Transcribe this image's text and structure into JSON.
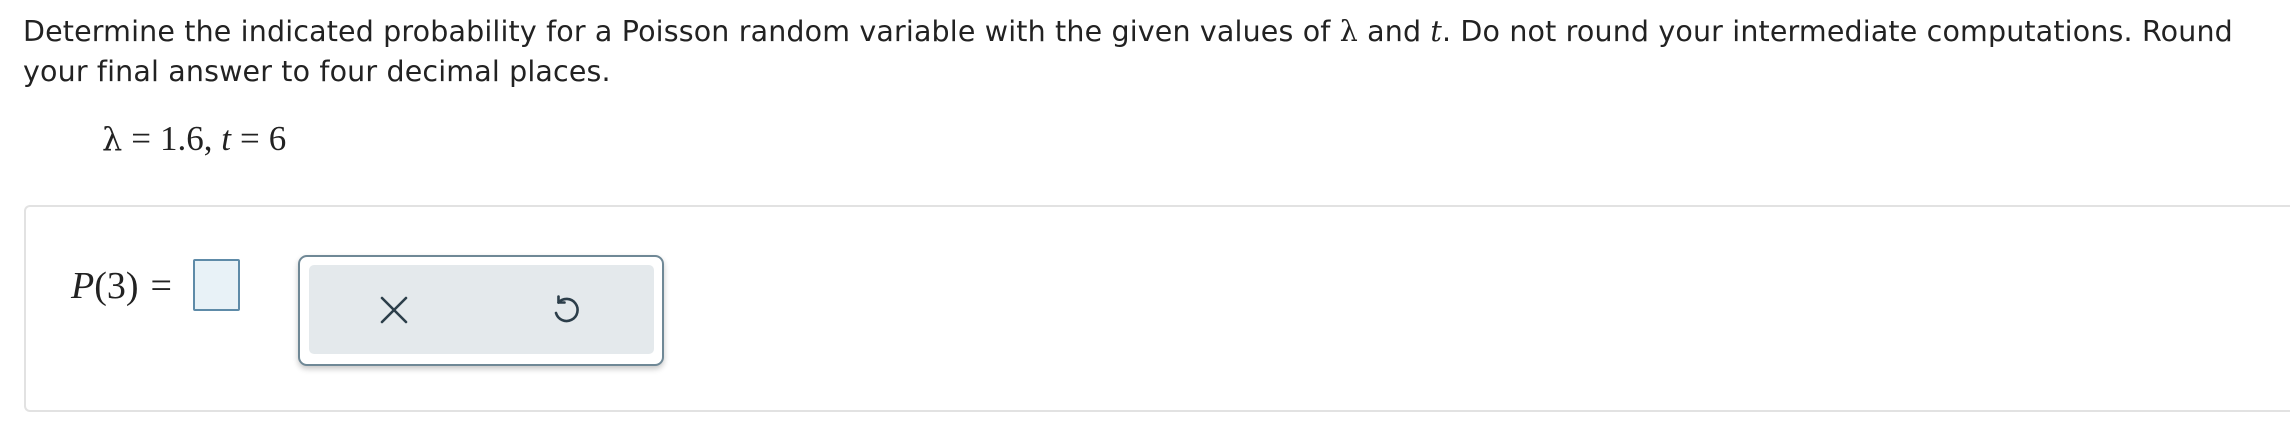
{
  "question": {
    "part1": "Determine the indicated probability for a Poisson random variable with the given values of ",
    "lambda_symbol": "λ",
    "part2": " and ",
    "t_symbol": "t",
    "part3": ". Do not round your intermediate computations. Round your final answer to four decimal places."
  },
  "given": {
    "lambda_symbol": "λ",
    "equals": "=",
    "lambda_value": "1.6,",
    "t_symbol": "t",
    "t_value": "6"
  },
  "answer": {
    "p_symbol": "P",
    "argument": "(3)",
    "equals": "=",
    "input_value": ""
  },
  "tools": {
    "clear_icon": "close-icon",
    "undo_icon": "undo-icon"
  },
  "colors": {
    "input_border": "#5e8ba8",
    "input_fill": "#e8f2f7",
    "toolbar_fill": "#e4e9ec",
    "toolbar_border": "#6f8896",
    "icon": "#2c3e4a"
  }
}
